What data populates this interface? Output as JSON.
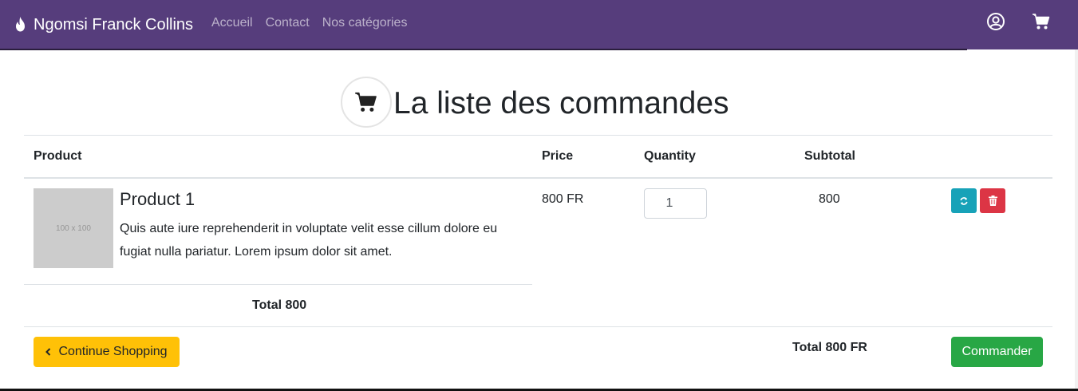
{
  "navbar": {
    "brand": "Ngomsi Franck Collins",
    "links": [
      "Accueil",
      "Contact",
      "Nos catégories"
    ],
    "background": "#563d7c"
  },
  "icons": {
    "brand": "flame-icon",
    "account": "user-circle-icon",
    "cart": "shopping-cart-icon"
  },
  "page": {
    "title": "La liste des commandes"
  },
  "table": {
    "headers": {
      "product": "Product",
      "price": "Price",
      "quantity": "Quantity",
      "subtotal": "Subtotal"
    },
    "rows": [
      {
        "thumb_label": "100 x 100",
        "name": "Product 1",
        "description": "Quis aute iure reprehenderit in voluptate velit esse cillum dolore eu fugiat nulla pariatur. Lorem ipsum dolor sit amet.",
        "price": "800 FR",
        "quantity": "1",
        "subtotal": "800"
      }
    ],
    "total_label": "Total 800"
  },
  "footer": {
    "continue_label": "Continue Shopping",
    "total_label": "Total 800 FR",
    "order_label": "Commander"
  },
  "colors": {
    "refresh": "#17a2b8",
    "delete": "#dc3545",
    "continue": "#ffc107",
    "order": "#28a745"
  }
}
